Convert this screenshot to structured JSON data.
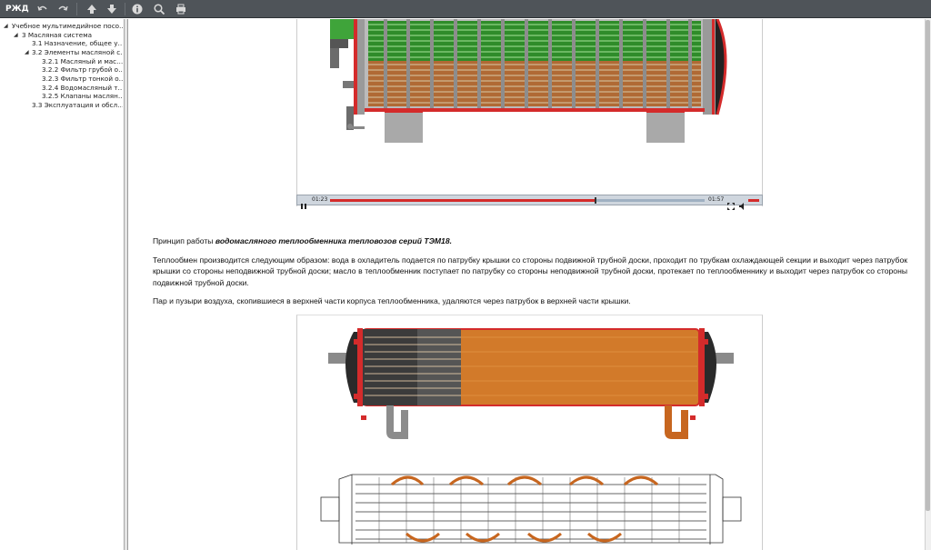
{
  "toolbar": {
    "logo": "РЖД",
    "buttons": [
      "back",
      "forward",
      "prev-page",
      "next-page",
      "info",
      "search",
      "print"
    ]
  },
  "tree": {
    "items": [
      {
        "label": "Учебное мультимедийное посо…",
        "level": 0,
        "expanded": true
      },
      {
        "label": "3 Масляная система",
        "level": 1,
        "expanded": true
      },
      {
        "label": "3.1 Назначение, общее у…",
        "level": 2
      },
      {
        "label": "3.2 Элементы масляной с…",
        "level": 2,
        "expanded": true
      },
      {
        "label": "3.2.1 Масляный и мас…",
        "level": 3
      },
      {
        "label": "3.2.2 Фильтр грубой о…",
        "level": 3
      },
      {
        "label": "3.2.3 Фильтр тонкой о…",
        "level": 3
      },
      {
        "label": "3.2.4 Водомасляный т…",
        "level": 3
      },
      {
        "label": "3.2.5 Клапаны маслян…",
        "level": 3
      },
      {
        "label": "3.3 Эксплуатация и обсл…",
        "level": 2
      }
    ]
  },
  "video": {
    "current_time": "01:23",
    "total_time": "01:57",
    "progress": 0.709
  },
  "content": {
    "p1_prefix": "Принцип работы ",
    "p1_emph": "водомасляного теплообменника тепловозов серий ТЭМ18.",
    "p2": "Теплообмен производится следующим образом: вода в охладитель подается по патрубку крышки со стороны подвижной трубной доски, проходит по трубкам охлаждающей секции и выходит через патрубок крышки со стороны неподвижной трубной доски; масло в теплообменник поступает по патрубку со стороны неподвижной трубной доски, протекает по теплообменнику и выходит через патрубок со стороны подвижной трубной доски.",
    "p3": "Пар и пузыри воздуха, скопившиеся в верхней части корпуса теплообменника, удаляются через патрубок в верхней части крышки."
  },
  "colors": {
    "toolbar": "#4f5459",
    "accent_red": "#d42b2b",
    "water_green": "#4caf3a",
    "oil_orange": "#c7661f"
  }
}
